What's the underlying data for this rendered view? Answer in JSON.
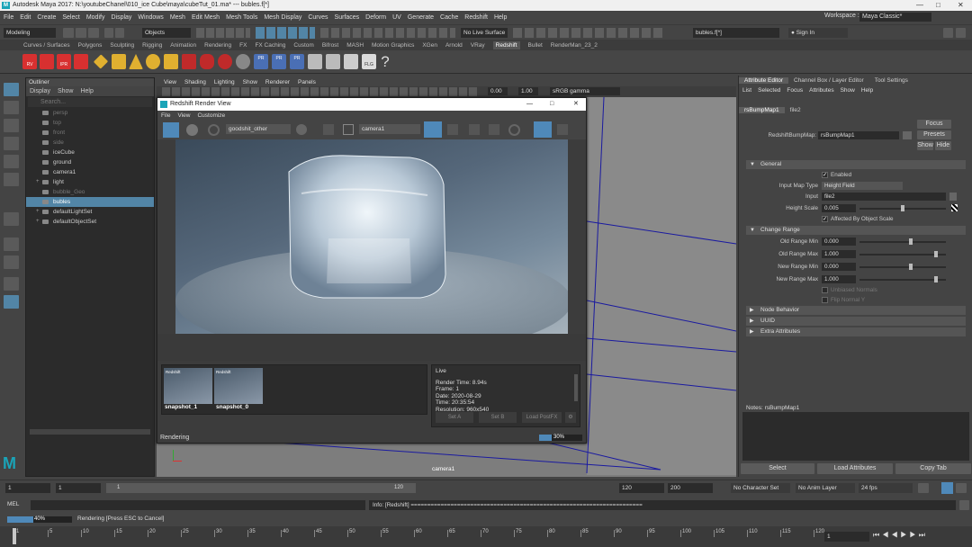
{
  "window": {
    "title": "Autodesk Maya 2017: N:\\youtubeChanel\\010_ice Cube\\maya\\cubeTut_01.ma*   ---   bubles.f[*]"
  },
  "menubar": {
    "items": [
      "File",
      "Edit",
      "Create",
      "Select",
      "Modify",
      "Display",
      "Windows",
      "Mesh",
      "Edit Mesh",
      "Mesh Tools",
      "Mesh Display",
      "Curves",
      "Surfaces",
      "Deform",
      "UV",
      "Generate",
      "Cache",
      "Redshift",
      "Help"
    ],
    "workspace_label": "Workspace :",
    "workspace_value": "Maya Classic*"
  },
  "statusline": {
    "mode": "Modeling",
    "selection_mode": "Objects",
    "live_surface": "No Live Surface",
    "selection_field": "bubles.f[*]",
    "sign_in": "Sign In"
  },
  "shelf_tabs": [
    "Curves / Surfaces",
    "Polygons",
    "Sculpting",
    "Rigging",
    "Animation",
    "Rendering",
    "FX",
    "FX Caching",
    "Custom",
    "Bifrost",
    "MASH",
    "Motion Graphics",
    "XGen",
    "Arnold",
    "VRay",
    "Redshift",
    "Bullet",
    "RenderMan_23_2"
  ],
  "shelf_active": "Redshift",
  "shelf_icon_labels": [
    "RV",
    "IPR",
    "PR",
    "PR",
    "PR",
    "FLG"
  ],
  "outliner": {
    "title": "Outliner",
    "menu": [
      "Display",
      "Show",
      "Help"
    ],
    "search_placeholder": "Search...",
    "items": [
      {
        "label": "persp",
        "dim": true
      },
      {
        "label": "top",
        "dim": true
      },
      {
        "label": "front",
        "dim": true
      },
      {
        "label": "side",
        "dim": true
      },
      {
        "label": "iceCube",
        "dim": false
      },
      {
        "label": "ground",
        "dim": false
      },
      {
        "label": "camera1",
        "dim": false
      },
      {
        "label": "light",
        "dim": false
      },
      {
        "label": "bubble_Geo",
        "dim": true
      },
      {
        "label": "bubles",
        "dim": false,
        "selected": true
      },
      {
        "label": "defaultLightSet",
        "dim": false
      },
      {
        "label": "defaultObjectSet",
        "dim": false
      }
    ]
  },
  "viewport": {
    "menu": [
      "View",
      "Shading",
      "Lighting",
      "Show",
      "Renderer",
      "Panels"
    ],
    "field1": "0.00",
    "field2": "1.00",
    "color_space": "sRGB gamma",
    "camera_label": "camera1"
  },
  "render_view": {
    "title": "Redshift Render View",
    "menu": [
      "File",
      "View",
      "Customize"
    ],
    "aov": "goodshit_other",
    "camera": "camera1",
    "snapshots": [
      {
        "label": "snapshot_1",
        "brand": "Redshift"
      },
      {
        "label": "snapshot_0",
        "brand": "Redshift"
      }
    ],
    "live_title": "Live",
    "info": [
      "Render Time: 8.94s",
      "Frame: 1",
      "Date: 2020-08-29",
      "Time: 20:35:54",
      "Resolution: 960x540"
    ],
    "buttons": [
      "Set A",
      "Set B",
      "Load PostFX"
    ],
    "status": "Rendering",
    "progress_text": "30%",
    "progress": 0.3
  },
  "attribute_editor": {
    "tabs": [
      "Attribute Editor",
      "Channel Box / Layer Editor",
      "Tool Settings"
    ],
    "menu": [
      "List",
      "Selected",
      "Focus",
      "Attributes",
      "Show",
      "Help"
    ],
    "node_tabs": [
      "rsBumpMap1",
      "file2"
    ],
    "node_label": "RedshiftBumpMap:",
    "node_value": "rsBumpMap1",
    "focus_btn": "Focus",
    "presets_btn": "Presets",
    "show_btn": "Show",
    "hide_btn": "Hide",
    "general_section": "General",
    "enabled_label": "Enabled",
    "input_map_type_label": "Input Map Type",
    "input_map_type_value": "Height Field",
    "input_label": "Input",
    "input_value": "file2",
    "height_scale_label": "Height Scale",
    "height_scale_value": "0.005",
    "affected_label": "Affected By Object Scale",
    "change_range_section": "Change Range",
    "ranges": [
      {
        "label": "Old Range Min",
        "value": "0.000"
      },
      {
        "label": "Old Range Max",
        "value": "1.000"
      },
      {
        "label": "New Range Min",
        "value": "0.000"
      },
      {
        "label": "New Range Max",
        "value": "1.000"
      }
    ],
    "unbiased_label": "Unbiased Normals",
    "flip_label": "Flip Normal Y",
    "collapsed_sections": [
      "Node Behavior",
      "UUID",
      "Extra Attributes"
    ],
    "notes_label": "Notes:  rsBumpMap1",
    "bottom_buttons": [
      "Select",
      "Load Attributes",
      "Copy Tab"
    ]
  },
  "timebar": {
    "start": "1",
    "current": "1",
    "range_start": "1",
    "range_end": "120",
    "end": "120",
    "end2": "200",
    "character_set": "No Character Set",
    "anim_layer": "No Anim Layer",
    "fps": "24 fps"
  },
  "cmdline": {
    "lang": "MEL",
    "info": "Info:  [Redshift] ======================================================================"
  },
  "helpline": {
    "progress_text": "40%",
    "progress": 0.4,
    "message": "Rendering [Press ESC to Cancel]"
  },
  "timeline": {
    "ticks": [
      "1",
      "5",
      "10",
      "15",
      "20",
      "25",
      "30",
      "35",
      "40",
      "45",
      "50",
      "55",
      "60",
      "65",
      "70",
      "75",
      "80",
      "85",
      "90",
      "95",
      "100",
      "105",
      "110",
      "115",
      "120"
    ],
    "current_frame": "1"
  }
}
